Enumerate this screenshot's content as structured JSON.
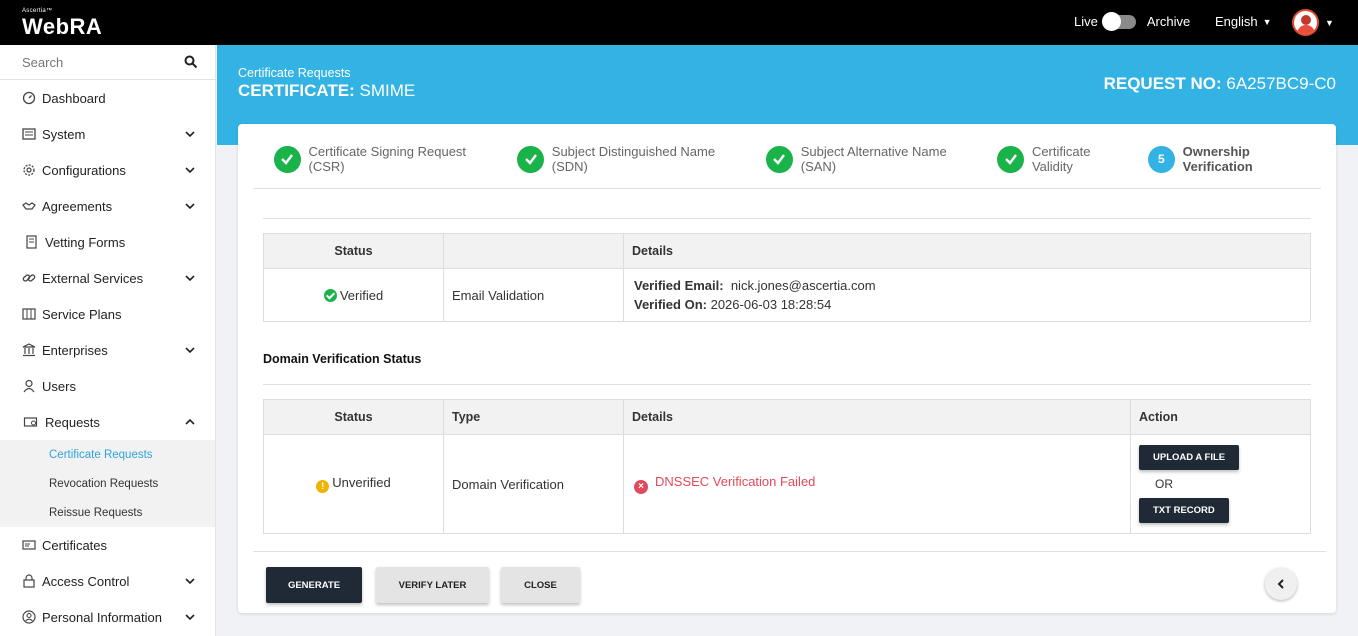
{
  "app": {
    "brand_small": "Ascertia™",
    "brand": "WebRA"
  },
  "topbar": {
    "live_label": "Live",
    "archive_label": "Archive",
    "language": "English"
  },
  "sidebar": {
    "search_placeholder": "Search",
    "items": [
      {
        "label": "Dashboard",
        "icon": "dashboard-icon"
      },
      {
        "label": "System",
        "icon": "system-icon"
      },
      {
        "label": "Configurations",
        "icon": "gear-icon"
      },
      {
        "label": "Agreements",
        "icon": "handshake-icon"
      },
      {
        "label": "Vetting Forms",
        "icon": "form-icon"
      },
      {
        "label": "External Services",
        "icon": "link-icon"
      },
      {
        "label": "Service Plans",
        "icon": "plans-icon"
      },
      {
        "label": "Enterprises",
        "icon": "bank-icon"
      },
      {
        "label": "Users",
        "icon": "users-icon"
      },
      {
        "label": "Requests",
        "icon": "requests-icon"
      },
      {
        "label": "Certificates",
        "icon": "certificate-icon"
      },
      {
        "label": "Access Control",
        "icon": "lock-icon"
      },
      {
        "label": "Personal Information",
        "icon": "user-icon"
      }
    ],
    "requests_sub": [
      "Certificate Requests",
      "Revocation Requests",
      "Reissue Requests"
    ]
  },
  "header": {
    "breadcrumb": "Certificate Requests",
    "title_prefix": "CERTIFICATE:",
    "title_value": "SMIME",
    "request_prefix": "REQUEST NO:",
    "request_value": "6A257BC9-C0"
  },
  "steps": [
    {
      "label": "Certificate Signing Request (CSR)",
      "state": "done"
    },
    {
      "label": "Subject Distinguished Name (SDN)",
      "state": "done"
    },
    {
      "label": "Subject Alternative Name (SAN)",
      "state": "done"
    },
    {
      "label": "Certificate Validity",
      "state": "done"
    },
    {
      "label": "Ownership Verification",
      "state": "current",
      "number": "5"
    }
  ],
  "email_table": {
    "headers": [
      "Status",
      "",
      "Details"
    ],
    "row": {
      "status": "Verified",
      "type": "Email Validation",
      "email_label": "Verified Email:",
      "email_value": "nick.jones@ascertia.com",
      "on_label": "Verified On:",
      "on_value": "2026-06-03 18:28:54"
    }
  },
  "domain_section_title": "Domain Verification Status",
  "domain_table": {
    "headers": [
      "Status",
      "Type",
      "Details",
      "Action"
    ],
    "row": {
      "status": "Unverified",
      "type": "Domain Verification",
      "details": "DNSSEC Verification Failed",
      "upload_label": "UPLOAD A FILE",
      "or_label": "OR",
      "txt_label": "TXT RECORD"
    }
  },
  "footer": {
    "generate": "GENERATE",
    "verify_later": "VERIFY LATER",
    "close": "CLOSE"
  },
  "colors": {
    "accent": "#32b3e3",
    "success": "#19b34a",
    "error": "#e14a5c",
    "dark": "#1f2a36"
  }
}
